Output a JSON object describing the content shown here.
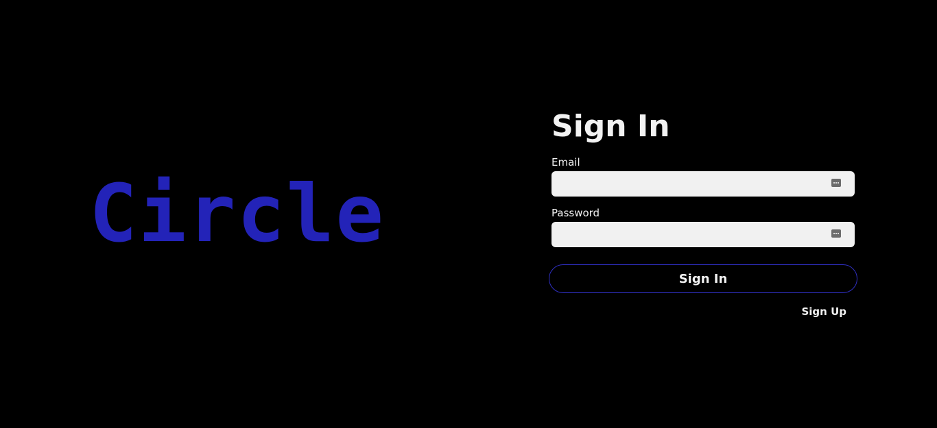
{
  "brand": {
    "logo_text": "Circle",
    "logo_color": "#2323b8"
  },
  "form": {
    "title": "Sign In",
    "email": {
      "label": "Email",
      "value": "",
      "placeholder": ""
    },
    "password": {
      "label": "Password",
      "value": "",
      "placeholder": ""
    },
    "field_icon": "password-manager-key-icon",
    "submit_label": "Sign In",
    "signup_label": "Sign Up"
  },
  "colors": {
    "background": "#000000",
    "text": "#f2f2f2",
    "input_background": "#f1f1f1",
    "button_border": "#2f2fc2"
  }
}
